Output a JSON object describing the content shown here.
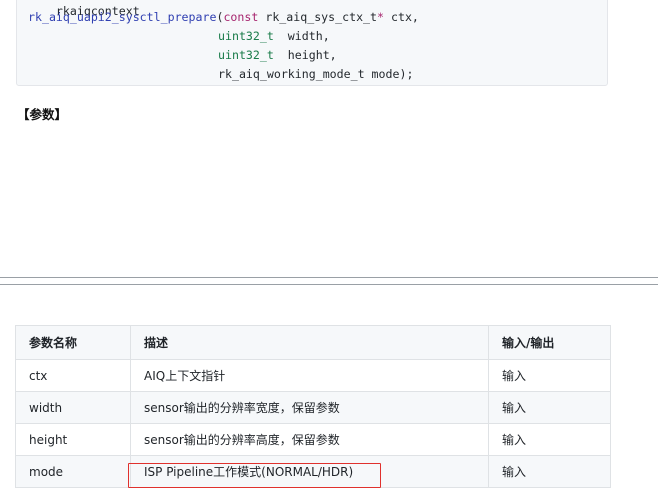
{
  "code": {
    "line0": "rkaiqcontext",
    "line1": {
      "fn": "rk_aiq_uapi2_sysctl_prepare",
      "open": "(",
      "kw": "const",
      "type": " rk_aiq_sys_ctx_t",
      "ptr": "*",
      "rest": " ctx,"
    },
    "line2": {
      "type": "uint32_t",
      "rest": "  width,"
    },
    "line3": {
      "type": "uint32_t",
      "rest": "  height,"
    },
    "line4": {
      "rest": "rk_aiq_working_mode_t mode);"
    }
  },
  "params_heading": "【参数】",
  "table": {
    "headers": [
      "参数名称",
      "描述",
      "输入/输出"
    ],
    "rows": [
      {
        "name": "ctx",
        "desc": "AIQ上下文指针",
        "io": "输入"
      },
      {
        "name": "width",
        "desc": "sensor输出的分辨率宽度，保留参数",
        "io": "输入"
      },
      {
        "name": "height",
        "desc": "sensor输出的分辨率高度，保留参数",
        "io": "输入"
      },
      {
        "name": "mode",
        "desc": "ISP Pipeline工作模式(NORMAL/HDR)",
        "io": "输入"
      }
    ]
  },
  "colors": {
    "code_bg": "#f6f8fa",
    "function": "#2f3fb1",
    "keyword": "#a7266f",
    "type": "#197b49",
    "highlight_border": "#e0312d"
  }
}
